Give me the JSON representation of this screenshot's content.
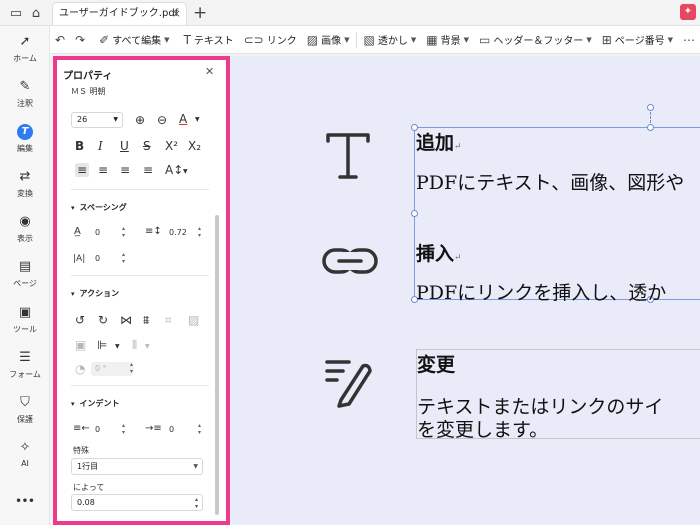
{
  "tab": {
    "title": "ユーザーガイドブック.pdf *",
    "close": "×"
  },
  "toolbar": {
    "edit_all": "すべて編集",
    "text": "テキスト",
    "link": "リンク",
    "image": "画像",
    "watermark": "透かし",
    "background": "背景",
    "header_footer": "ヘッダー＆フッター",
    "page_number": "ページ番号"
  },
  "rail": {
    "home": "ホーム",
    "comment": "注釈",
    "edit": "編集",
    "convert": "変換",
    "view": "表示",
    "page": "ページ",
    "tools": "ツール",
    "form": "フォーム",
    "protect": "保護",
    "ai": "AI",
    "more": "•••"
  },
  "panel": {
    "title": "プロパティ",
    "font_name": "ＭＳ 明朝",
    "font_size": "26",
    "spacing_title": "スペーシング",
    "char_spacing": "0",
    "line_spacing": "0.72",
    "word_spacing": "0",
    "action_title": "アクション",
    "rotation": "0 °",
    "indent_title": "インデント",
    "indent_left": "0",
    "indent_right": "0",
    "special_label": "特殊",
    "special_value": "1行目",
    "by_label": "によって",
    "by_value": "0.08"
  },
  "canvas": {
    "item1_heading": "追加",
    "item1_body": "PDFにテキスト、画像、図形や",
    "item2_heading": "挿入",
    "item2_body": "PDFにリンクを挿入し、透か",
    "item3_heading": "変更",
    "item3_body_line1": "テキストまたはリンクのサイ",
    "item3_body_line2": "を変更します。",
    "return_mark": "↵"
  },
  "colors": {
    "accent": "#2f7bf5",
    "highlight": "#ee3a8c",
    "canvas": "#e9ebf8"
  }
}
